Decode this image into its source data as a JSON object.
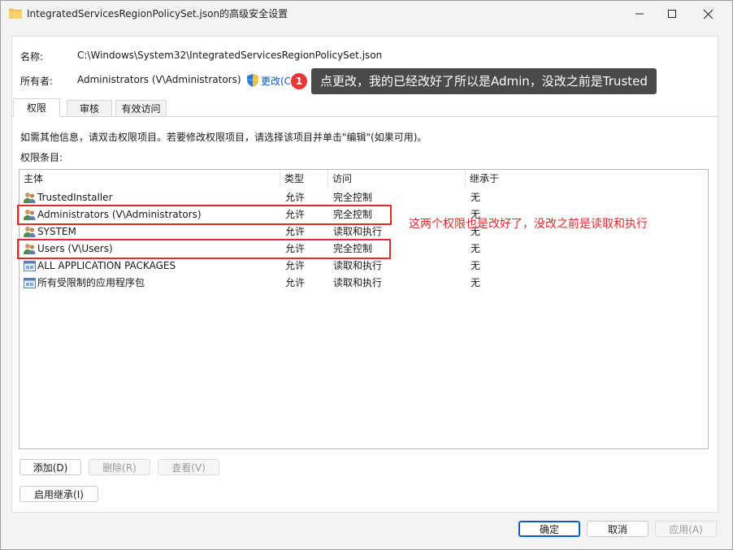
{
  "window": {
    "title": "IntegratedServicesRegionPolicySet.json的高级安全设置"
  },
  "info": {
    "name_label": "名称:",
    "name_value": "C:\\Windows\\System32\\IntegratedServicesRegionPolicySet.json",
    "owner_label": "所有者:",
    "owner_value": "Administrators (V\\Administrators)",
    "change_link": "更改(C)"
  },
  "annotation": {
    "badge_number": "1",
    "callout_text": "点更改，我的已经改好了所以是Admin，没改之前是Trusted",
    "red_note": "这两个权限也是改好了，没改之前是读取和执行",
    "highlight_color": "#e02b2b"
  },
  "tabs": [
    {
      "label": "权限",
      "active": true
    },
    {
      "label": "审核",
      "active": false
    },
    {
      "label": "有效访问",
      "active": false
    }
  ],
  "instructions": "如需其他信息，请双击权限项目。若要修改权限项目，请选择该项目并单击\"编辑\"(如果可用)。",
  "entries_label": "权限条目:",
  "table": {
    "columns": [
      "主体",
      "类型",
      "访问",
      "继承于"
    ],
    "rows": [
      {
        "principal": "TrustedInstaller",
        "type": "允许",
        "access": "完全控制",
        "inherited": "无",
        "icon": "users-icon"
      },
      {
        "principal": "Administrators (V\\Administrators)",
        "type": "允许",
        "access": "完全控制",
        "inherited": "无",
        "icon": "users-icon"
      },
      {
        "principal": "SYSTEM",
        "type": "允许",
        "access": "读取和执行",
        "inherited": "无",
        "icon": "users-icon"
      },
      {
        "principal": "Users (V\\Users)",
        "type": "允许",
        "access": "完全控制",
        "inherited": "无",
        "icon": "users-icon"
      },
      {
        "principal": "ALL APPLICATION PACKAGES",
        "type": "允许",
        "access": "读取和执行",
        "inherited": "无",
        "icon": "app-package-icon"
      },
      {
        "principal": "所有受限制的应用程序包",
        "type": "允许",
        "access": "读取和执行",
        "inherited": "无",
        "icon": "app-package-icon"
      }
    ]
  },
  "buttons": {
    "add": "添加(D)",
    "remove": "删除(R)",
    "view": "查看(V)",
    "enable_inheritance": "启用继承(I)",
    "ok": "确定",
    "cancel": "取消",
    "apply": "应用(A)"
  },
  "colors": {
    "link": "#0a5bc4",
    "badge": "#e53935",
    "callout_bg": "#4a4a4a"
  }
}
